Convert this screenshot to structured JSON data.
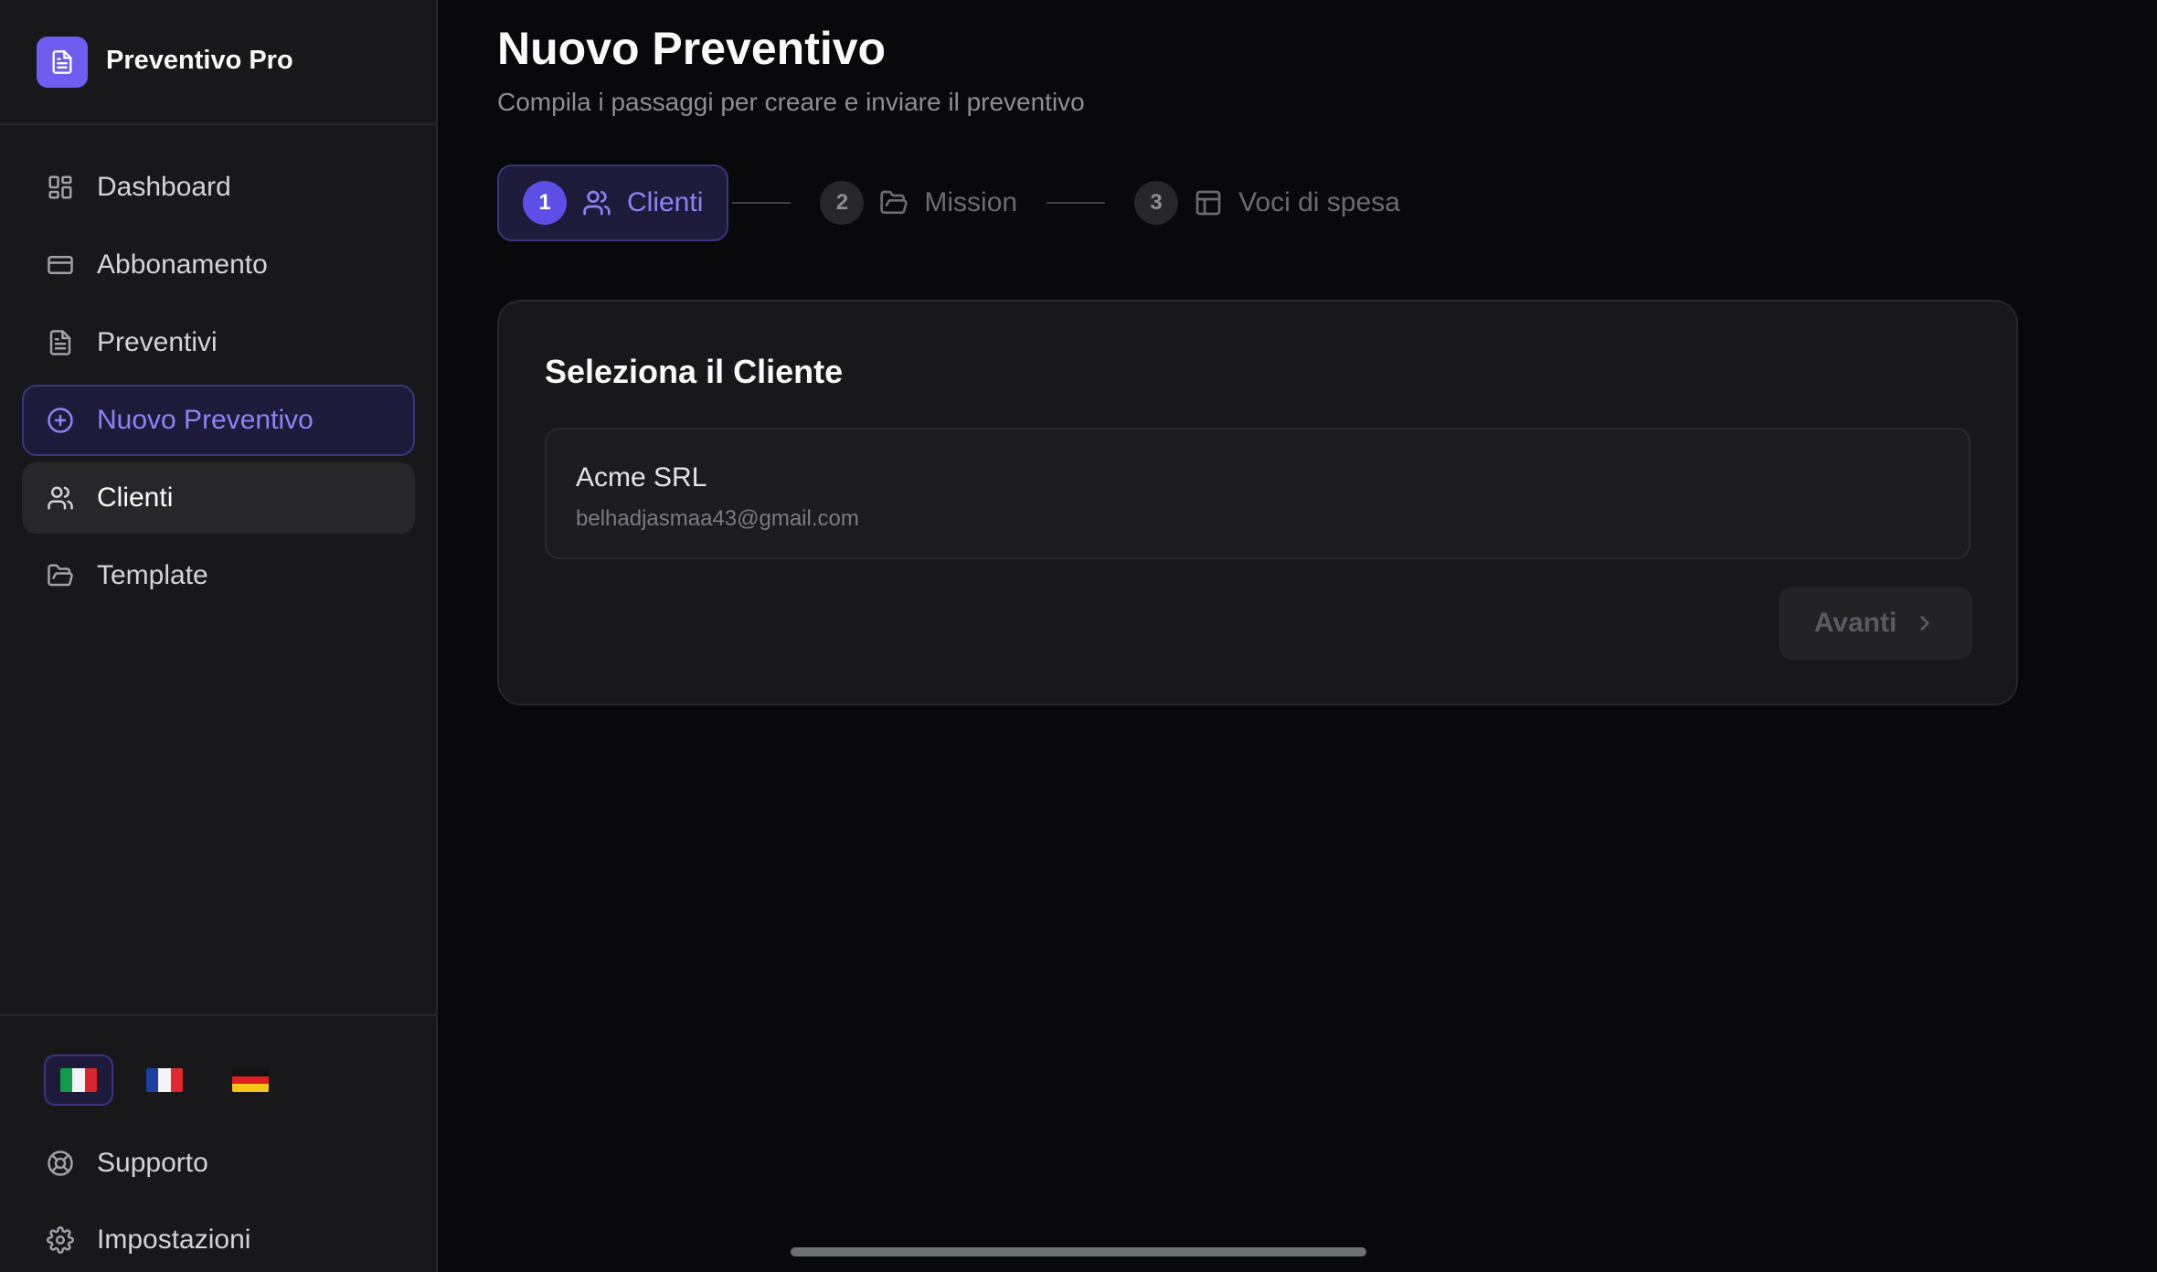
{
  "app": {
    "name": "Preventivo Pro"
  },
  "sidebar": {
    "items": [
      {
        "label": "Dashboard",
        "icon": "layout-grid-icon"
      },
      {
        "label": "Abbonamento",
        "icon": "credit-card-icon"
      },
      {
        "label": "Preventivi",
        "icon": "file-text-icon"
      },
      {
        "label": "Nuovo Preventivo",
        "icon": "plus-circle-icon",
        "state": "active"
      },
      {
        "label": "Clienti",
        "icon": "users-icon",
        "state": "hover"
      },
      {
        "label": "Template",
        "icon": "folder-open-icon"
      }
    ],
    "languages": [
      {
        "code": "it",
        "flag": "italy-flag-icon",
        "state": "active"
      },
      {
        "code": "fr",
        "flag": "france-flag-icon"
      },
      {
        "code": "de",
        "flag": "germany-flag-icon"
      }
    ],
    "bottom_items": [
      {
        "label": "Supporto",
        "icon": "life-buoy-icon"
      },
      {
        "label": "Impostazioni",
        "icon": "gear-icon"
      }
    ]
  },
  "page": {
    "title": "Nuovo Preventivo",
    "subtitle": "Compila i passaggi per creare e inviare il preventivo"
  },
  "stepper": {
    "steps": [
      {
        "number": "1",
        "label": "Clienti",
        "icon": "users-icon",
        "state": "active"
      },
      {
        "number": "2",
        "label": "Mission",
        "icon": "folder-open-icon"
      },
      {
        "number": "3",
        "label": "Voci di spesa",
        "icon": "table-icon"
      }
    ]
  },
  "card": {
    "title": "Seleziona il Cliente",
    "clients": [
      {
        "name": "Acme SRL",
        "email": "belhadjasmaa43@gmail.com"
      }
    ],
    "next_label": "Avanti"
  },
  "colors": {
    "accent": "#5b4fe5",
    "accent_text": "#8b84f5",
    "background": "#09090b",
    "sidebar_bg": "#18181b",
    "card_bg": "#18181b"
  }
}
